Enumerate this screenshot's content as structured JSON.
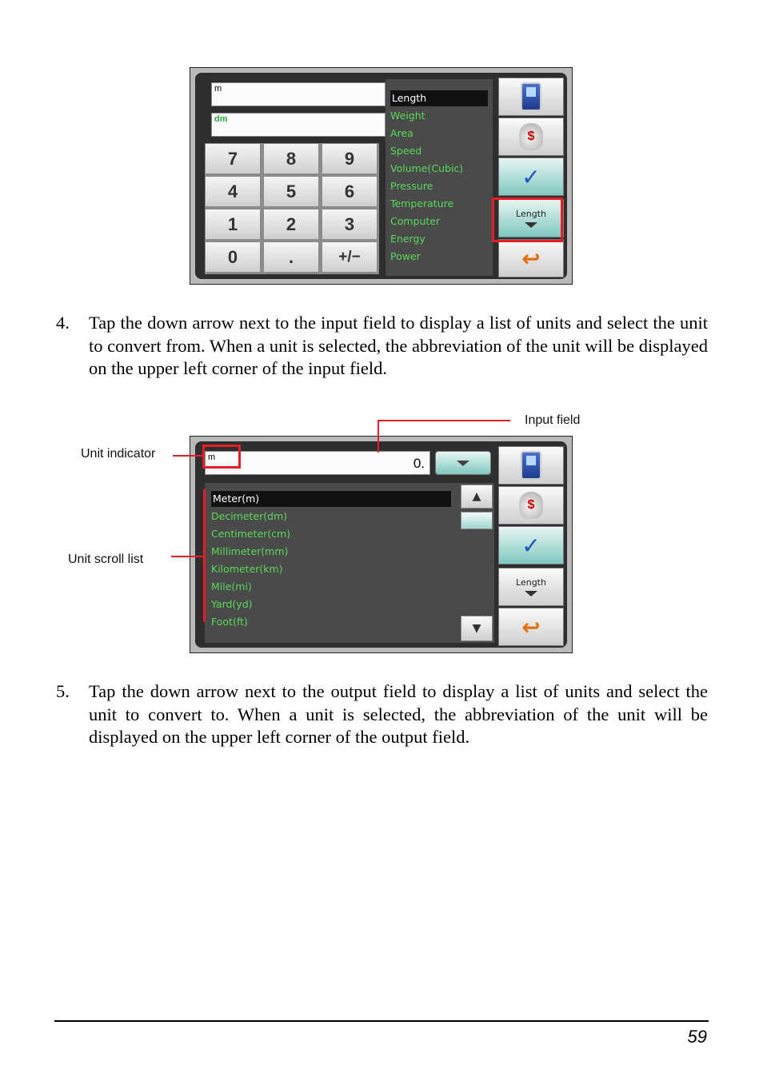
{
  "figure1": {
    "input_unit": "m",
    "output_unit": "dm",
    "keys": [
      "7",
      "8",
      "9",
      "4",
      "5",
      "6",
      "1",
      "2",
      "3",
      "0",
      ".",
      "+/−"
    ],
    "categories": [
      "Length",
      "Weight",
      "Area",
      "Speed",
      "Volume(Cubic)",
      "Pressure",
      "Temperature",
      "Computer",
      "Energy",
      "Power"
    ],
    "selected_category": "Length",
    "category_button_label": "Length"
  },
  "figure2": {
    "unit_indicator": "m",
    "input_value": "0.",
    "units": [
      "Meter(m)",
      "Decimeter(dm)",
      "Centimeter(cm)",
      "Millimeter(mm)",
      "Kilometer(km)",
      "Mile(mi)",
      "Yard(yd)",
      "Foot(ft)"
    ],
    "selected_unit": "Meter(m)",
    "category_button_label": "Length",
    "callouts": {
      "input_field": "Input field",
      "unit_indicator": "Unit indicator",
      "unit_scroll_list": "Unit scroll list"
    }
  },
  "steps": [
    {
      "number": "4.",
      "text": "Tap the down arrow next to the input field to display a list of units and select the unit to convert from. When a unit is selected, the abbreviation of the unit will be displayed on the upper left corner of the input field."
    },
    {
      "number": "5.",
      "text": "Tap the down arrow next to the output field to display a list of units and select the unit to convert to. When a unit is selected, the abbreviation of the unit will be displayed on the upper left corner of the output field."
    }
  ],
  "page_number": "59",
  "colors": {
    "highlight_red": "#e41e26",
    "list_green": "#5ad85a"
  }
}
